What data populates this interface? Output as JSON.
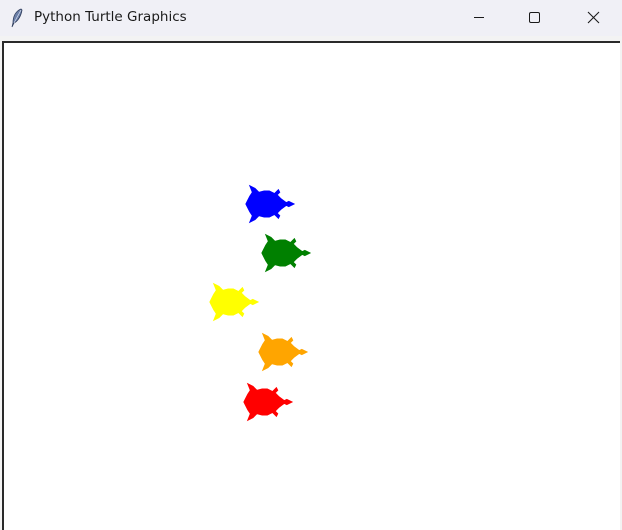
{
  "window": {
    "title": "Python Turtle Graphics",
    "icon": "feather-icon",
    "controls": [
      "minimize-icon",
      "maximize-icon",
      "close-icon"
    ]
  },
  "canvas": {
    "background": "#ffffff",
    "turtles": [
      {
        "name": "blue",
        "color": "#0000ff",
        "heading": "east"
      },
      {
        "name": "green",
        "color": "#008000",
        "heading": "east"
      },
      {
        "name": "yellow",
        "color": "#ffff00",
        "heading": "east"
      },
      {
        "name": "orange",
        "color": "#ffa500",
        "heading": "east"
      },
      {
        "name": "red",
        "color": "#ff0000",
        "heading": "east"
      }
    ]
  }
}
